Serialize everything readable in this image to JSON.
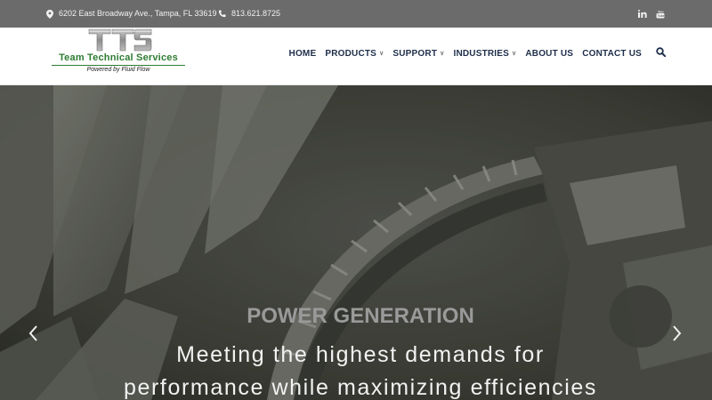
{
  "topbar": {
    "address": "6202 East Broadway Ave., Tampa, FL 33619",
    "phone": "813.621.8725",
    "icons": [
      "map-marker-icon",
      "phone-icon",
      "linkedin-icon",
      "youtube-icon"
    ]
  },
  "logo": {
    "name": "Team Technical Services",
    "tagline": "Powered by Fluid Flow"
  },
  "nav": {
    "items": [
      {
        "label": "HOME",
        "dropdown": false
      },
      {
        "label": "PRODUCTS",
        "dropdown": true
      },
      {
        "label": "SUPPORT",
        "dropdown": true
      },
      {
        "label": "INDUSTRIES",
        "dropdown": true
      },
      {
        "label": "ABOUT US",
        "dropdown": false
      },
      {
        "label": "CONTACT US",
        "dropdown": false
      }
    ],
    "search_icon": "search-icon"
  },
  "hero": {
    "title": "POWER GENERATION",
    "subtitle_line1": "Meeting the highest demands for",
    "subtitle_line2": "performance while maximizing efficiencies"
  },
  "colors": {
    "topbar_bg": "#6b6b6b",
    "nav_text": "#1e2e4a",
    "logo_green": "#2e7d32",
    "hero_title": "#9a9a9a"
  }
}
